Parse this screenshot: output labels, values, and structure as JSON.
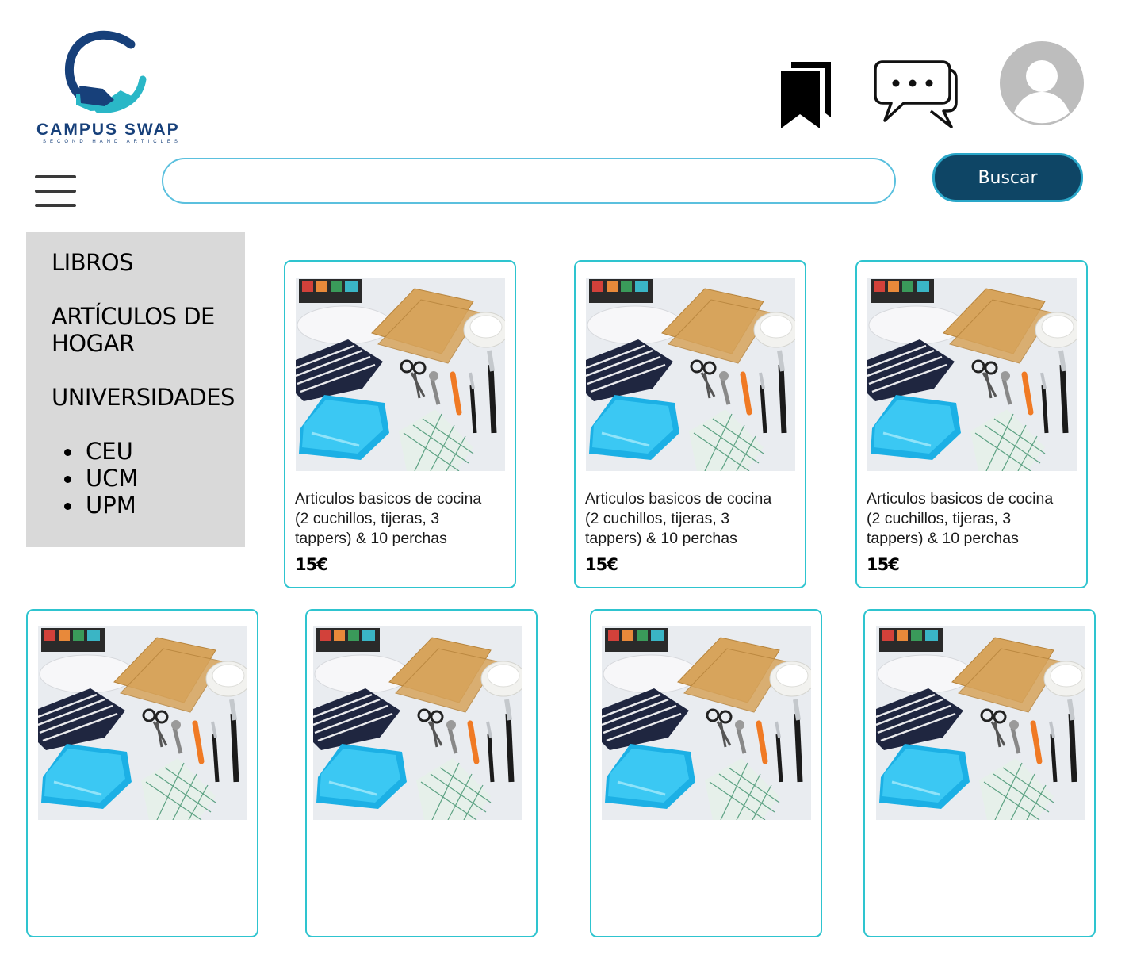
{
  "brand": {
    "name": "CAMPUS SWAP",
    "tagline": "SECOND HAND ARTICLES"
  },
  "header": {
    "icons": [
      "bookmarks-icon",
      "chat-icon",
      "profile-avatar-icon"
    ]
  },
  "search": {
    "placeholder": "",
    "value": "",
    "button_label": "Buscar"
  },
  "sidebar": {
    "items": [
      {
        "label": "LIBROS"
      },
      {
        "label": "ARTÍCULOS DE"
      },
      {
        "label": "HOGAR"
      },
      {
        "label": "UNIVERSIDADES"
      }
    ],
    "universities": [
      "CEU",
      "UCM",
      "UPM"
    ]
  },
  "products": [
    {
      "title_lines": [
        "Articulos basicos de cocina",
        "(2 cuchillos, tijeras, 3",
        "tappers) & 10 perchas"
      ],
      "price": "15€"
    },
    {
      "title_lines": [
        "Articulos basicos de cocina",
        "(2 cuchillos, tijeras, 3",
        "tappers) & 10 perchas"
      ],
      "price": "15€"
    },
    {
      "title_lines": [
        "Articulos basicos de cocina",
        "(2 cuchillos, tijeras, 3",
        "tappers) & 10 perchas"
      ],
      "price": "15€"
    },
    {
      "title_lines": [],
      "price": ""
    },
    {
      "title_lines": [],
      "price": ""
    },
    {
      "title_lines": [],
      "price": ""
    },
    {
      "title_lines": [],
      "price": ""
    }
  ],
  "colors": {
    "accent": "#2ec4cf",
    "button": "#0e4565",
    "sidebar": "#d9d9d9",
    "brand": "#17407a"
  }
}
